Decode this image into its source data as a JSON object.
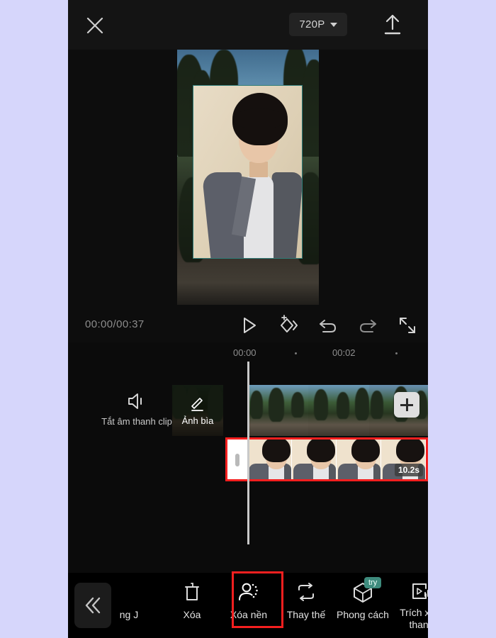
{
  "app": {
    "background_color": "#d6d6fb",
    "screen_background": "#0d0d0d"
  },
  "topbar": {
    "close_icon": "close-x-icon",
    "resolution_label": "720P",
    "resolution_caret_icon": "chevron-down-icon",
    "upload_icon": "upload-arrow-icon"
  },
  "player": {
    "time_label": "00:00/00:37",
    "current_time": "00:00",
    "total_time": "00:37",
    "controls": [
      {
        "name": "play-button",
        "icon": "play-triangle-icon"
      },
      {
        "name": "keyframe-button",
        "icon": "add-keyframe-diamond-icon"
      },
      {
        "name": "undo-button",
        "icon": "undo-arrow-icon"
      },
      {
        "name": "redo-button",
        "icon": "redo-arrow-icon"
      },
      {
        "name": "fullscreen-button",
        "icon": "expand-fullscreen-icon"
      }
    ]
  },
  "timeline": {
    "ruler_labels": [
      "00:00",
      "00:02"
    ],
    "mute_icon": "speaker-mute-icon",
    "mute_label": "Tắt âm thanh clip",
    "cover_label": "Ảnh bìa",
    "cover_icon": "pencil-edit-icon",
    "add_clip_icon": "plus-icon",
    "selected_clip_duration": "10.2s",
    "selection_color": "#f51f1f",
    "playhead_color": "#c9c9c9"
  },
  "bottombar": {
    "collapse_icon": "double-chevron-left-icon",
    "highlight_color": "#f51f1f",
    "badge_color": "#3e8b7d",
    "tools": [
      {
        "label": "ng\nJ",
        "icon": "partial-tool-icon",
        "clipped": true,
        "badge": ""
      },
      {
        "label": "Xóa",
        "icon": "trash-delete-icon",
        "badge": ""
      },
      {
        "label": "Xóa nền",
        "icon": "remove-background-person-icon",
        "badge": "",
        "highlighted": true
      },
      {
        "label": "Thay thế",
        "icon": "replace-loop-icon",
        "badge": ""
      },
      {
        "label": "Phong cách",
        "icon": "style-cube-icon",
        "badge": "try"
      },
      {
        "label": "Trích xuất thanh",
        "icon": "extract-audio-icon",
        "badge": "",
        "clipped": true
      }
    ]
  }
}
